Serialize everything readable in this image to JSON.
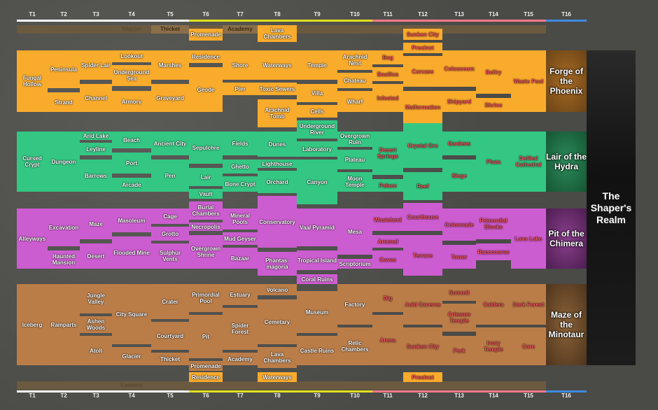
{
  "tiers": [
    "T1",
    "T2",
    "T3",
    "T4",
    "T5",
    "T6",
    "T7",
    "T8",
    "T9",
    "T10",
    "T11",
    "T12",
    "T13",
    "T14",
    "T15",
    "T16"
  ],
  "tier_colors": {
    "white": "#ffffff",
    "yellow": "#e0e020",
    "red": "#ff7a8a",
    "blue": "#3f8be0"
  },
  "top_strip": {
    "left_faded": "Glacier",
    "thicket": "Thicket",
    "academy": "Academy"
  },
  "bottom_strip": {
    "left_faded": "Lookout"
  },
  "shaper": "The Shaper's Realm",
  "guardians": [
    "Forge of the Phoenix",
    "Lair of the Hydra",
    "Pit of the Chimera",
    "Maze of the Minotaur"
  ],
  "maps": {
    "promenade_top": "Promenade",
    "lava_chambers_top": "Lava Chambers",
    "sunken_city_top": "Sunken City",
    "precinct_top": "Precinct",
    "fungal_hollow": "Fungal Hollow",
    "peninsula": "Peninsula",
    "strand": "Strand",
    "spider_lair": "Spider Lair",
    "channel": "Channel",
    "lookout": "Lookout",
    "underground_sea": "Underground Sea",
    "armory": "Armory",
    "marshes": "Marshes",
    "graveyard": "Graveyard",
    "residence_top": "Residence",
    "geode": "Geode",
    "shore": "Shore",
    "pier": "Pier",
    "waterways_top": "Waterways",
    "toxic_sewers": "Toxic Sewers",
    "arachnid_tomb": "Arachnid Tomb",
    "temple": "Temple",
    "villa": "Villa",
    "cells": "Cells",
    "arachnid_nest": "Arachnid Nest",
    "chateau": "Chateau",
    "wharf": "Wharf",
    "bog": "Bog",
    "basilica": "Basilica",
    "infested": "Infested",
    "carcass": "Carcass",
    "malformation": "Malformation",
    "colosseum": "Colosseum",
    "shipyard": "Shipyard",
    "belfry": "Belfry",
    "shrine": "Shrine",
    "waste_pool": "Waste Pool",
    "cursed_crypt": "Cursed Crypt",
    "dungeon": "Dungeon",
    "arid_lake": "Arid Lake",
    "leyline": "Leyline",
    "barrows": "Barrows",
    "beach": "Beach",
    "port": "Port",
    "arcade": "Arcade",
    "ancient_city": "Ancient City",
    "pen": "Pen",
    "sepulchre": "Sepulchre",
    "lair": "Lair",
    "vault": "Vault",
    "fields": "Fields",
    "ghetto": "Ghetto",
    "bone_crypt": "Bone Crypt",
    "dunes": "Dunes",
    "lighthouse": "Lighthouse",
    "orchard": "Orchard",
    "underground_river": "Underground River",
    "laboratory": "Laboratory",
    "canyon": "Canyon",
    "overgrown_ruin": "Overgrown Ruin",
    "plateau": "Plateau",
    "moon_temple": "Moon Temple",
    "desert_springs": "Desert Springs",
    "palace": "Palace",
    "crystal_ore": "Crystal Ore",
    "reef": "Reef",
    "gardens": "Gardens",
    "siege": "Siege",
    "plaza": "Plaza",
    "defiled_cathedral": "Defiled Cathedral",
    "alleyways": "Alleyways",
    "excavation": "Excavation",
    "haunted_mansion": "Haunted Mansion",
    "maze": "Maze",
    "desert": "Desert",
    "mausoleum": "Masoleum",
    "flooded_mine": "Flooded Mine",
    "cage": "Cage",
    "grotto": "Grotto",
    "sulphur_vents": "Sulphur Vents",
    "burial_chambers": "Burial Chambers",
    "necropolis": "Necropolis",
    "overgrown_shrine": "Overgrown Shrine",
    "mineral_pools": "Mineral Pools",
    "mud_geyser": "Mud Geyser",
    "bazaar": "Bazaar",
    "conservatory": "Conservatory",
    "phantasmagoria": "Phantas-magoria",
    "vaal_pyramid": "Vaal Pyramid",
    "tropical_island": "Tropical Island",
    "mesa": "Mesa",
    "scriptorium": "Scriptorium",
    "wasteland": "Wasteland",
    "arsenal": "Arsenal",
    "coves": "Coves",
    "courthouse": "Courthouse",
    "terrace": "Terrace",
    "colonnade": "Colonnade",
    "tower": "Tower",
    "primordial_blocks": "Primordial Blocks",
    "racecourse": "Racecourse",
    "lava_lake": "Lava Lake",
    "coral_ruins": "Coral Ruins",
    "iceberg": "Iceberg",
    "ramparts": "Ramparts",
    "jungle_valley": "Jungle Valley",
    "ashen_woods": "Ashen Woods",
    "atoll": "Atoll",
    "city_square": "City Square",
    "glacier": "Glacier",
    "crater": "Crater",
    "courtyard": "Courtyard",
    "thicket": "Thicket",
    "primordial_pool": "Primordial Pool",
    "pit": "Pit",
    "estuary": "Estuary",
    "spider_forest": "Spider Forest",
    "academy": "Academy",
    "volcano": "Volcano",
    "cemetary": "Cemetary",
    "lava_chambers_bot": "Lava Chambers",
    "museum": "Museum",
    "castle_ruins": "Castle Ruins",
    "factory": "Factory",
    "relic_chambers": "Relic Chambers",
    "dig": "Dig",
    "arena": "Arena",
    "acid_caverns": "Acid Caverns",
    "sunken_city_bot": "Sunken City",
    "summit": "Summit",
    "crimson_temple": "Crimson Temple",
    "park": "Park",
    "caldera": "Caldera",
    "ivory_temple": "Ivory Temple",
    "dark_forest": "Dark Forest",
    "core": "Core",
    "promenade_bot": "Promenade",
    "residence_bot": "Residence",
    "waterways_bot": "Waterways",
    "precinct_bot": "Precinct"
  }
}
